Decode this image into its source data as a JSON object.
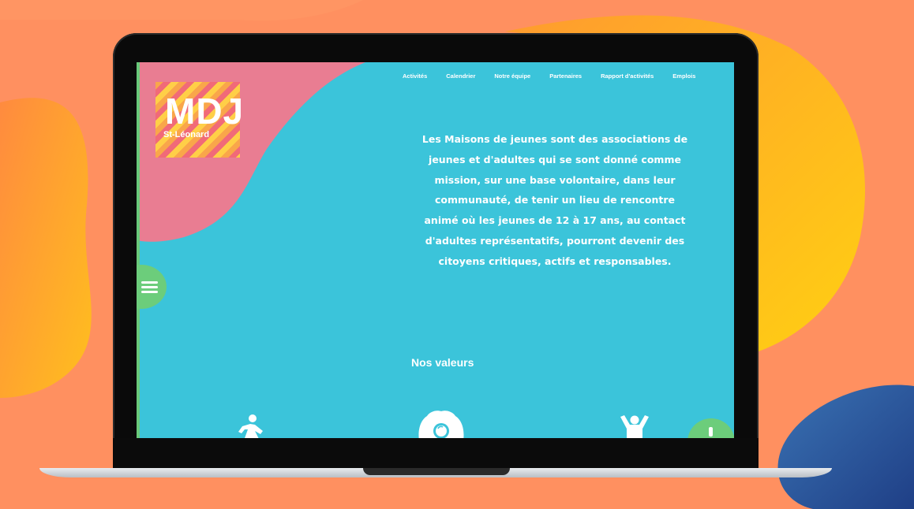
{
  "colors": {
    "background": "#ff8f55",
    "screen": "#3bc4da",
    "pink_shape": "#e97d92",
    "green_accent": "#6ccd7b",
    "white": "#ffffff"
  },
  "logo": {
    "main": "MDJ",
    "sub": "St-Léonard"
  },
  "nav": {
    "items": [
      "Activités",
      "Calendrier",
      "Notre équipe",
      "Partenaires",
      "Rapport d'activités",
      "Emplois"
    ]
  },
  "intro": {
    "text": "Les Maisons de jeunes sont des associations de jeunes et d'adultes qui se sont donné comme mission, sur une base volontaire, dans leur communauté, de tenir un lieu de rencontre animé où les jeunes de 12 à 17 ans, au contact d'adultes représentatifs, pourront devenir des citoyens critiques, actifs et responsables."
  },
  "values": {
    "title": "Nos valeurs",
    "icons": [
      "running-person-icon",
      "brain-lightbulb-icon",
      "cheering-person-icon"
    ]
  },
  "controls": {
    "menu_icon": "hamburger-icon",
    "help_icon": "exclamation-icon"
  }
}
